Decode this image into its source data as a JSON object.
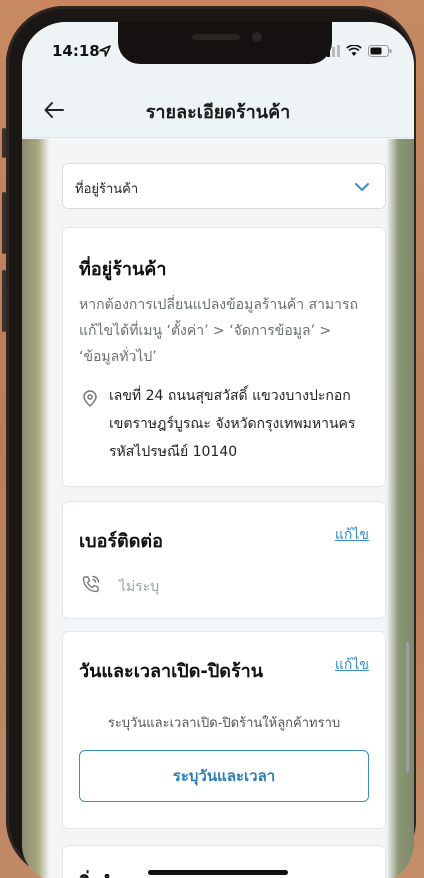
{
  "status_bar": {
    "time": "14:18"
  },
  "header": {
    "title": "รายละเอียดร้านค้า"
  },
  "dropdown": {
    "selected": "ที่อยู่ร้านค้า"
  },
  "address_card": {
    "title": "ที่อยู่ร้านค้า",
    "description_lines": [
      "หากต้องการเปลี่ยนแปลงข้อมูลร้านค้า สามารถ",
      "แก้ไขได้ที่เมนู ‘ตั้งค่า’ > ‘จัดการข้อมูล’ >",
      "‘ข้อมูลทั่วไป’"
    ],
    "address_lines": [
      "เลขที่ 24 ถนนสุขสวัสดิ์ แขวงบางปะกอก",
      "เขตราษฎร์บูรณะ จังหวัดกรุงเทพมหานคร",
      "รหัสไปรษณีย์ 10140"
    ]
  },
  "contact_card": {
    "title": "เบอร์ติดต่อ",
    "edit_label": "แก้ไข",
    "phone_value": "ไม่ระบุ"
  },
  "hours_card": {
    "title": "วันและเวลาเปิด-ปิดร้าน",
    "edit_label": "แก้ไข",
    "description": "ระบุวันและเวลาเปิด-ปิดร้านให้ลูกค้าทราบ",
    "button_label": "ระบุวันและเวลา"
  },
  "amenities_card": {
    "title": "สิ่งอำนวยความสะดวก"
  },
  "colors": {
    "accent": "#3a8fc4",
    "background": "#f4f6f7"
  }
}
